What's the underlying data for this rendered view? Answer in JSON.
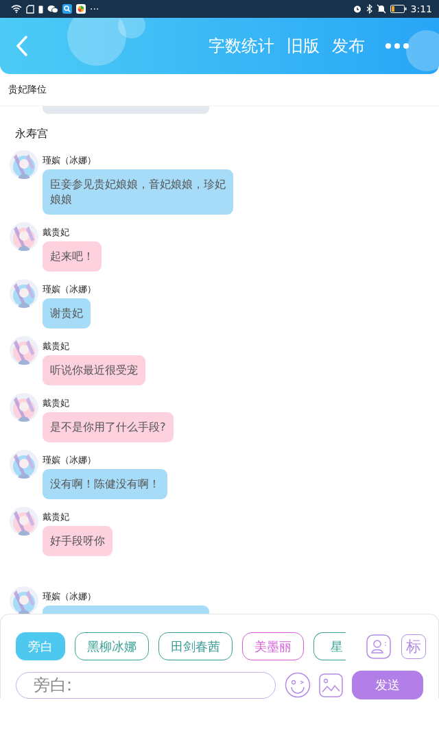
{
  "status_bar": {
    "overflow": "···",
    "time": "3:11"
  },
  "header": {
    "actions": [
      "字数统计",
      "旧版",
      "发布"
    ]
  },
  "title": "贵妃降位",
  "chat": [
    {
      "kind": "cut-top"
    },
    {
      "kind": "section",
      "text": "永寿宫"
    },
    {
      "kind": "message",
      "name": "瑾嫔（冰娜）",
      "text": "臣妾参见贵妃娘娘，音妃娘娘，珍妃娘娘",
      "color": "#a6dcf8"
    },
    {
      "kind": "message",
      "name": "戴贵妃",
      "text": "起来吧！",
      "color": "#fdd1dd"
    },
    {
      "kind": "message",
      "name": "瑾嫔（冰娜）",
      "text": "谢贵妃",
      "color": "#a6dcf8"
    },
    {
      "kind": "message",
      "name": "戴贵妃",
      "text": "听说你最近很受宠",
      "color": "#fdd1dd"
    },
    {
      "kind": "message",
      "name": "戴贵妃",
      "text": "是不是你用了什么手段?",
      "color": "#fdd1dd"
    },
    {
      "kind": "message",
      "name": "瑾嫔（冰娜）",
      "text": "没有啊！陈健没有啊！",
      "color": "#a6dcf8"
    },
    {
      "kind": "message",
      "name": "戴贵妃",
      "text": "好手段呀你",
      "color": "#fdd1dd"
    },
    {
      "kind": "cut-message",
      "name": "瑾嫔（冰娜）",
      "color": "#a6dcf8"
    }
  ],
  "composer": {
    "roles": [
      {
        "label": "旁白",
        "selected": true,
        "color": "#4fc8f0"
      },
      {
        "label": "黑柳冰娜",
        "selected": false,
        "color": "#3aa597"
      },
      {
        "label": "田剑春茜",
        "selected": false,
        "color": "#3a9c97"
      },
      {
        "label": "美墨丽",
        "selected": false,
        "color": "#d45fd6"
      },
      {
        "label": "星",
        "selected": false,
        "color": "#3aa597"
      }
    ],
    "mark_button": "标",
    "placeholder": "旁白:",
    "send": "发送"
  }
}
